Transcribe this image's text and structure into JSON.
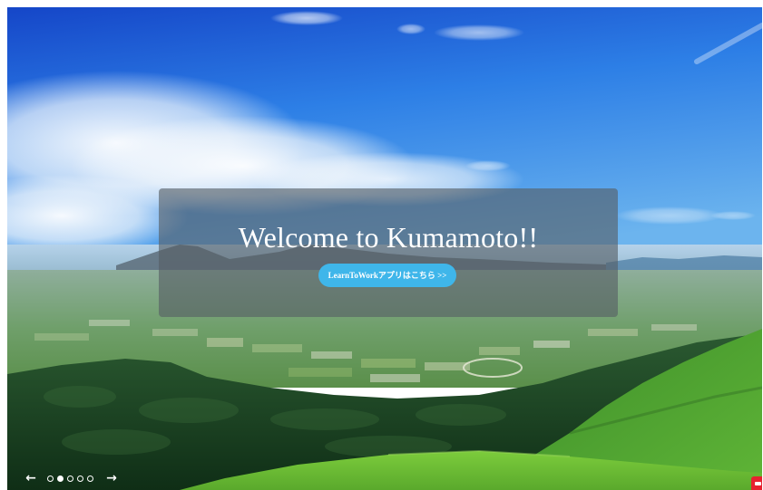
{
  "hero": {
    "title": "Welcome to Kumamoto!!",
    "cta_label": "LearnToWorkアプリはこちら >>",
    "colors": {
      "cta_background": "#3fb6ea",
      "overlay": "#565d64",
      "sky": "#1a5fd4",
      "grass": "#5eb82f",
      "forest": "#1c4a24"
    }
  },
  "carousel": {
    "prev_icon": "←",
    "next_icon": "→",
    "slide_count": 5,
    "active_slide": 2,
    "slides": [
      {
        "active": false
      },
      {
        "active": true
      },
      {
        "active": false
      },
      {
        "active": false
      },
      {
        "active": false
      }
    ]
  },
  "widget": {
    "icon": "chat-icon",
    "color": "#e7212f"
  }
}
